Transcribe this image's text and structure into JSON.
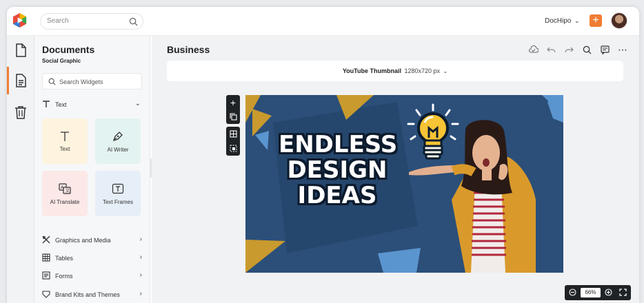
{
  "topbar": {
    "search_placeholder": "Search",
    "brand_name": "DocHipo",
    "plus_label": "+"
  },
  "rail": {
    "items": [
      {
        "icon": "page-icon"
      },
      {
        "icon": "document-icon"
      },
      {
        "icon": "trash-icon"
      }
    ]
  },
  "panel": {
    "title": "Documents",
    "subtitle": "Social Graphic",
    "widget_search_placeholder": "Search Widgets",
    "text_section": "Text",
    "cards": [
      {
        "label": "Text",
        "icon": "text-icon",
        "bg": "#fdf3de"
      },
      {
        "label": "AI Writer",
        "icon": "pen-icon",
        "bg": "#e3f3f1"
      },
      {
        "label": "AI Translate",
        "icon": "translate-icon",
        "bg": "#fbe8e7"
      },
      {
        "label": "Text Frames",
        "icon": "text-frame-icon",
        "bg": "#e6eef7"
      }
    ],
    "menu": [
      {
        "label": "Graphics and Media",
        "icon": "shapes-icon"
      },
      {
        "label": "Tables",
        "icon": "table-icon"
      },
      {
        "label": "Forms",
        "icon": "form-icon"
      },
      {
        "label": "Brand Kits and Themes",
        "icon": "brand-kit-icon"
      }
    ]
  },
  "main": {
    "title": "Business",
    "size_name": "YouTube Thumbnail",
    "size_dims": "1280x720 px",
    "zoom": "66%"
  },
  "canvas": {
    "headline_lines": [
      "ENDLESS",
      "DESIGN",
      "IDEAS"
    ],
    "bg_color": "#2b4f79",
    "accent_gold": "#c99a2e",
    "accent_blue": "#5b95cf"
  },
  "colors": {
    "brand_orange": "#f07c33"
  }
}
